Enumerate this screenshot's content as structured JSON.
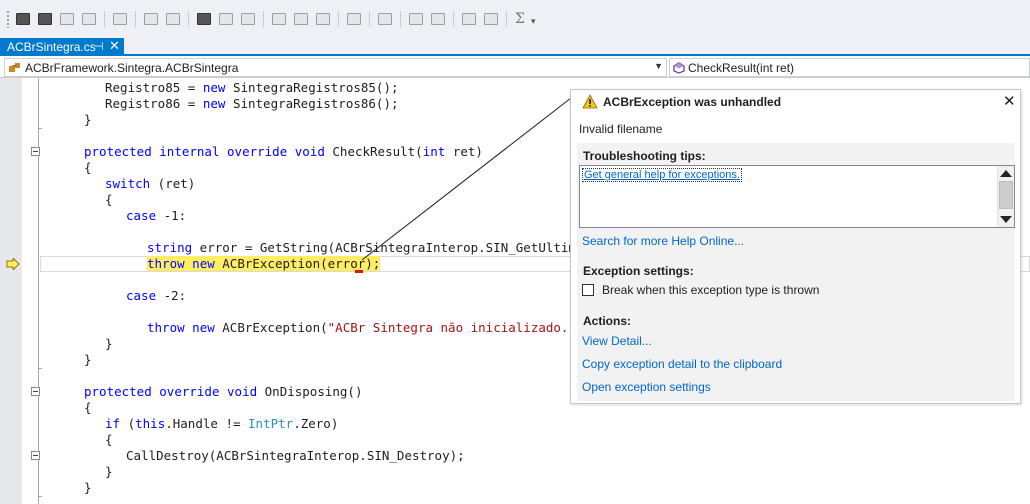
{
  "tab": {
    "label": "ACBrSintegra.cs",
    "pin": "⊣",
    "close": "✕"
  },
  "navbar": {
    "class_selector": "ACBrFramework.Sintegra.ACBrSintegra",
    "member_selector": "CheckResult(int ret)"
  },
  "toolbar": {
    "sigma": "Σ"
  },
  "code": {
    "l1": {
      "a": "Registro85 = ",
      "kw": "new",
      "b": " SintegraRegistros85();"
    },
    "l2": {
      "a": "Registro86 = ",
      "kw": "new",
      "b": " SintegraRegistros86();"
    },
    "l3": "}",
    "l4": {
      "kw1": "protected",
      "kw2": "internal",
      "kw3": "override",
      "kw4": "void",
      "name": " CheckResult(",
      "kw5": "int",
      "rest": " ret)"
    },
    "l5": "{",
    "l6": {
      "kw": "switch",
      "rest": " (ret)"
    },
    "l7": "{",
    "l8": {
      "kw": "case",
      "rest": " -1:"
    },
    "l9": {
      "kw": "string",
      "rest": " error = GetString(ACBrSintegraInterop.SIN_GetUltimoErr"
    },
    "l10": {
      "kw1": "throw",
      "kw2": "new",
      "rest": " ACBrException(error);"
    },
    "l11": {
      "kw": "case",
      "rest": " -2:"
    },
    "l12": {
      "kw1": "throw",
      "kw2": "new",
      "mid": " ACBrException(",
      "str": "\"ACBr Sintegra não inicializado.\"",
      "end": ");"
    },
    "l13": "}",
    "l14": "}",
    "l15": {
      "kw1": "protected",
      "kw2": "override",
      "kw3": "void",
      "rest": " OnDisposing()"
    },
    "l16": "{",
    "l17": {
      "kw1": "if",
      "a": " (",
      "kw2": "this",
      "b": ".Handle != ",
      "ty": "IntPtr",
      "c": ".Zero)"
    },
    "l18": "{",
    "l19": "CallDestroy(ACBrSintegraInterop.SIN_Destroy);",
    "l20": "}",
    "l21": "}"
  },
  "exception": {
    "title": "ACBrException was unhandled",
    "close": "✕",
    "message": "Invalid filename",
    "tips_title": "Troubleshooting tips:",
    "tips_link": "Get general help for exceptions.",
    "help_online": "Search for more Help Online...",
    "settings_title": "Exception settings:",
    "break_label": "Break when this exception type is thrown",
    "actions_title": "Actions:",
    "actions": [
      "View Detail...",
      "Copy exception detail to the clipboard",
      "Open exception settings"
    ]
  },
  "colors": {
    "accent": "#007acc",
    "keyword": "#0000ff",
    "type": "#2b91af",
    "string": "#a31515",
    "highlight": "#ffee62",
    "link": "#0066cc"
  },
  "icons": [
    "open-icon",
    "solution-icon",
    "print-icon",
    "save-icon",
    "indent-icon",
    "list-icon",
    "comment-icon",
    "bookmark-icon",
    "warning-icon",
    "execution-arrow-icon",
    "class-icon",
    "method-icon"
  ]
}
